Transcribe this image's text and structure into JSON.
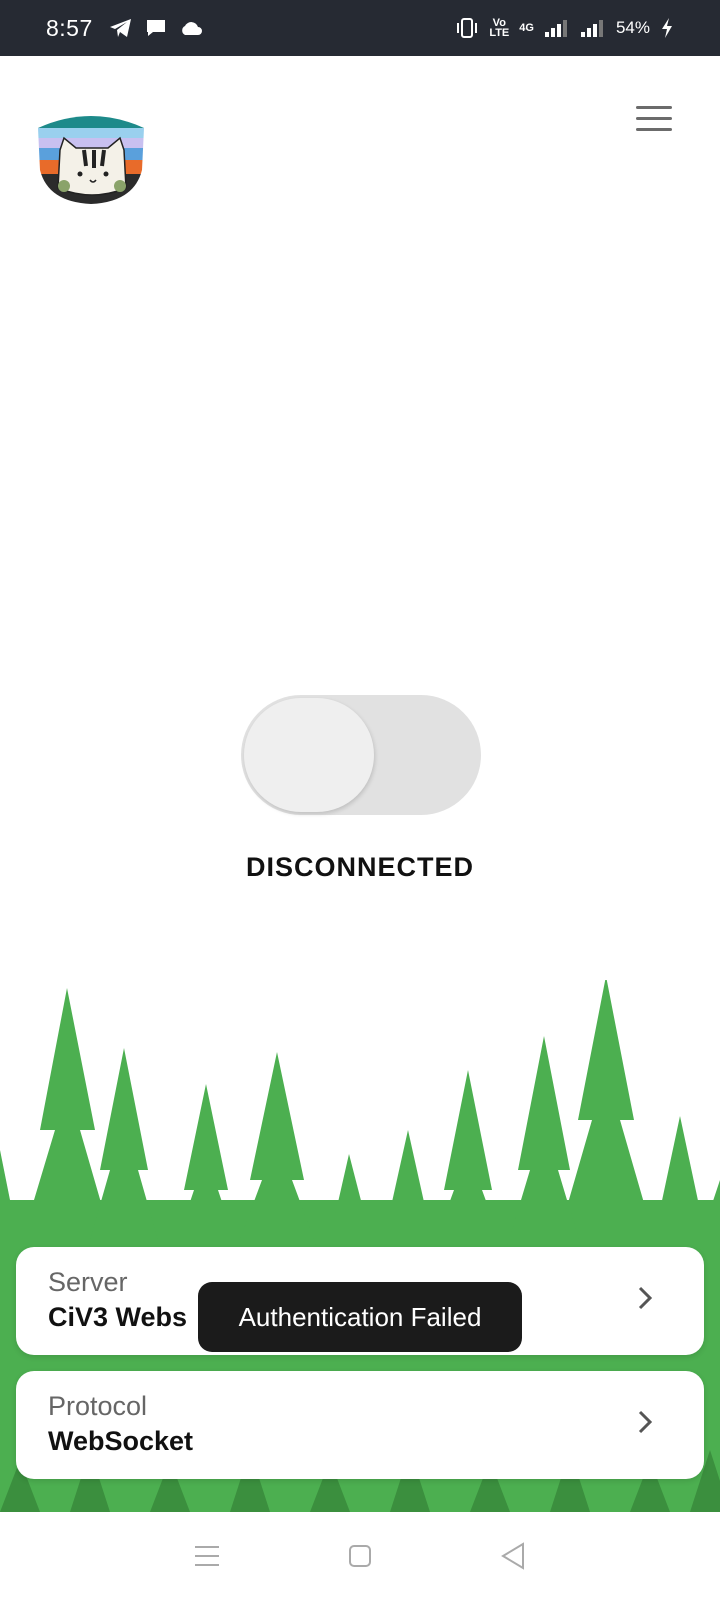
{
  "status_bar": {
    "time": "8:57",
    "network_top": "Vo",
    "network_bottom": "LTE",
    "cell_type": "4G",
    "battery": "54%"
  },
  "header": {
    "logo_icon": "cat-logo-icon",
    "menu_icon": "hamburger-menu-icon"
  },
  "connection": {
    "status": "DISCONNECTED",
    "toggle_state": "off"
  },
  "server_card": {
    "label": "Server",
    "value": "CiV3 Webs"
  },
  "protocol_card": {
    "label": "Protocol",
    "value": "WebSocket"
  },
  "toast": {
    "message": "Authentication Failed"
  },
  "colors": {
    "status_bar_bg": "#262a33",
    "tree_green": "#4caf50",
    "tree_dark": "#3b8f3e",
    "toast_bg": "#1b1b1b"
  }
}
